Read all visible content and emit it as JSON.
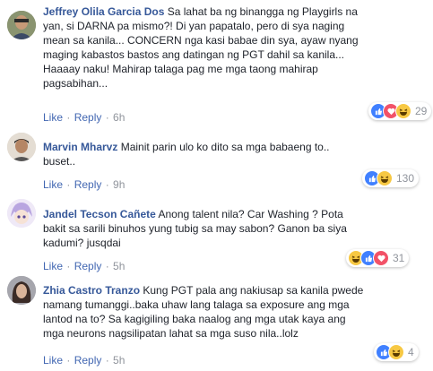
{
  "comments": [
    {
      "author": "Jeffrey Olila Garcia Dos",
      "lines": [
        "Sa lahat ba ng binangga ng Playgirls na",
        "yan, si DARNA pa mismo?! Di yan papatalo, pero di sya naging",
        "mean sa kanila... CONCERN nga kasi babae din sya, ayaw nyang",
        "maging kabastos bastos ang datingan ng PGT dahil sa kanila...",
        "Haaaay naku! Mahirap talaga pag me mga taong mahirap",
        "pagsabihan..."
      ],
      "like": "Like",
      "reply": "Reply",
      "time": "6h",
      "reaction_count": "29",
      "reactions": [
        "like-icon",
        "love-icon",
        "haha-icon"
      ]
    },
    {
      "author": "Marvin Mharvz",
      "lines": [
        "Mainit parin ulo ko dito sa mga babaeng to..",
        "buset.."
      ],
      "like": "Like",
      "reply": "Reply",
      "time": "9h",
      "reaction_count": "130",
      "reactions": [
        "like-icon",
        "haha-icon"
      ]
    },
    {
      "author": "Jandel Tecson Cañete",
      "lines": [
        "Anong talent nila? Car Washing ? Pota",
        "bakit sa sarili binuhos yung tubig sa may sabon? Ganon ba siya",
        "kadumi? jusqdai"
      ],
      "like": "Like",
      "reply": "Reply",
      "time": "5h",
      "reaction_count": "31",
      "reactions": [
        "haha-icon",
        "like-icon",
        "love-icon"
      ]
    },
    {
      "author": "Zhia Castro Tranzo",
      "lines": [
        "Kung PGT pala ang nakiusap sa kanila pwede",
        "namang tumanggi..baka uhaw lang talaga sa exposure ang mga",
        "lantod na to? Sa kagigiling baka naalog ang mga utak kaya ang",
        "mga neurons nagsilipatan lahat sa mga suso nila..lolz"
      ],
      "like": "Like",
      "reply": "Reply",
      "time": "5h",
      "reaction_count": "4",
      "reactions": [
        "like-icon",
        "haha-icon"
      ]
    }
  ],
  "colors": {
    "author": "#365899",
    "link": "#4267b2",
    "meta": "#90949c",
    "text": "#1d2129",
    "like": "#4080ff",
    "love": "#f25268",
    "haha": "#f7c843"
  }
}
